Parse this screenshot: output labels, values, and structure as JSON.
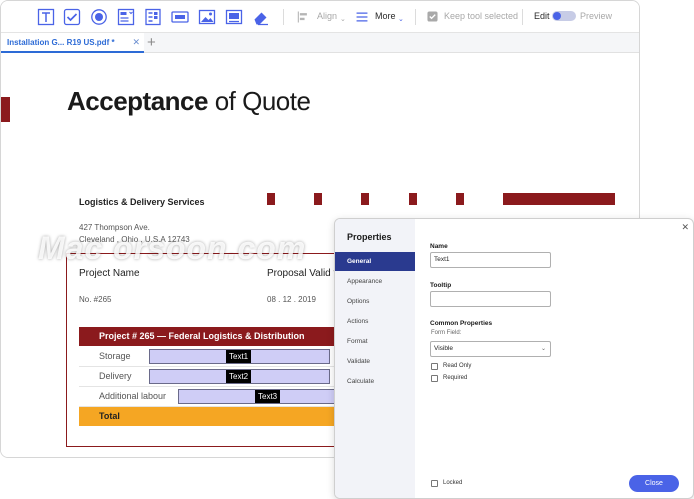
{
  "toolbar": {
    "align_label": "Align",
    "more_label": "More",
    "keep_tool_label": "Keep tool selected",
    "edit_label": "Edit",
    "preview_label": "Preview",
    "accent_color": "#4a63e7",
    "tools": [
      "text-field-icon",
      "checkbox-icon",
      "radio-button-icon",
      "list-box-icon",
      "combo-box-icon",
      "button-icon",
      "image-icon",
      "signature-icon",
      "eraser-icon"
    ]
  },
  "tabs": {
    "active_label": "Installation  G... R19 US.pdf *",
    "close_glyph": "✕",
    "add_glyph": "+"
  },
  "document": {
    "title_bold": "Acceptance",
    "title_rest": " of Quote",
    "company": "Logistics & Delivery Services",
    "address_line1": "427 Thompson Ave.",
    "address_line2": "Cleveland , Ohio , U.S.A 12743",
    "project_name_label": "Project Name",
    "proposal_valid_label": "Proposal Valid t",
    "project_number": "No. #265",
    "date": "08 . 12 . 2019",
    "project_bar": "Project # 265 — Federal Logistics & Distribution",
    "rows": [
      {
        "label": "Storage",
        "field": "Text1"
      },
      {
        "label": "Delivery",
        "field": "Text2"
      },
      {
        "label": "Additional labour",
        "field": "Text3"
      }
    ],
    "total_label": "Total",
    "brand_color": "#8b1a1d",
    "total_color": "#f5a623"
  },
  "watermark": "Mac orsoon.com",
  "properties": {
    "title": "Properties",
    "close_glyph": "✕",
    "tabs": [
      "General",
      "Appearance",
      "Options",
      "Actions",
      "Format",
      "Validate",
      "Calculate"
    ],
    "active_tab": "General",
    "name_label": "Name",
    "name_value": "Text1",
    "tooltip_label": "Tooltip",
    "tooltip_value": "",
    "common_label": "Common Properties",
    "form_field_label": "Form Field:",
    "form_field_value": "Visible",
    "read_only_label": "Read Only",
    "required_label": "Required",
    "locked_label": "Locked",
    "close_button": "Close"
  }
}
